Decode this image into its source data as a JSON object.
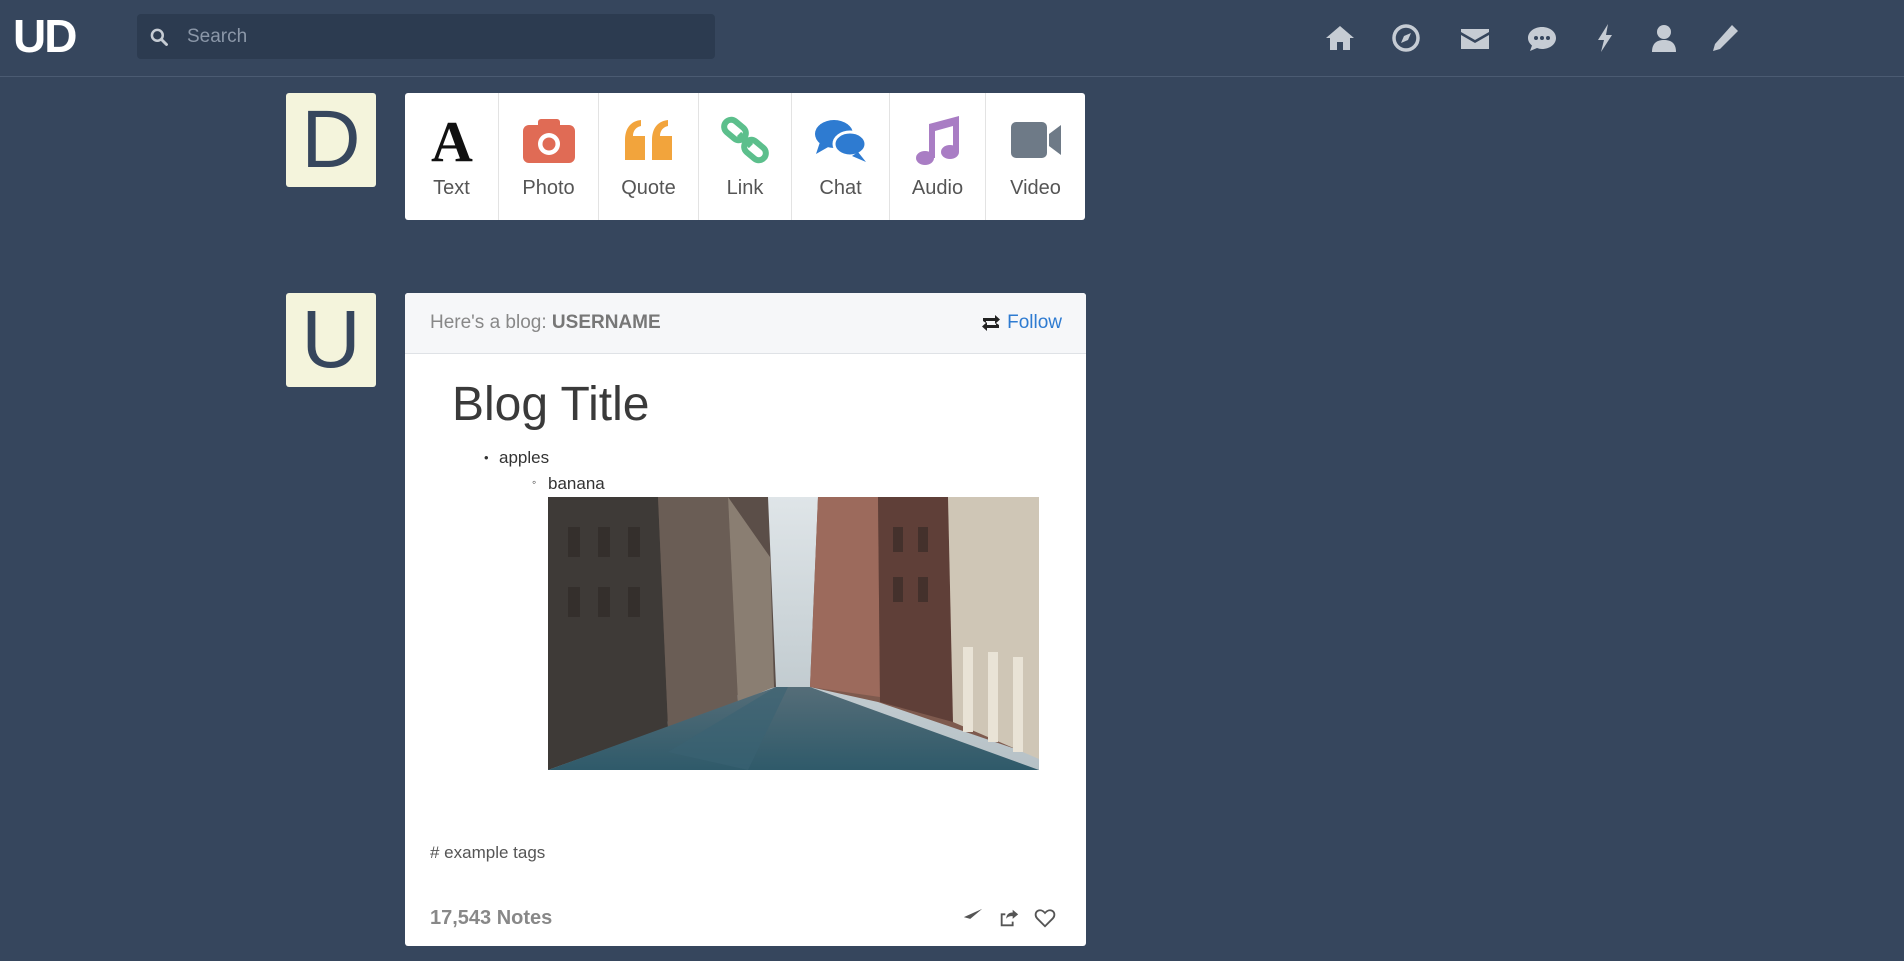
{
  "app": {
    "logo": "UD"
  },
  "search": {
    "placeholder": "Search",
    "value": ""
  },
  "nav": {
    "icons": [
      "home-icon",
      "explore-icon",
      "inbox-icon",
      "messages-icon",
      "activity-icon",
      "account-icon",
      "new-post-icon"
    ]
  },
  "avatars": {
    "dashboard_letter": "D",
    "blog_letter": "U"
  },
  "post_types": [
    {
      "label": "Text",
      "icon": "text-icon",
      "color": "#111111"
    },
    {
      "label": "Photo",
      "icon": "camera-icon",
      "color": "#e06b55"
    },
    {
      "label": "Quote",
      "icon": "quote-icon",
      "color": "#f2a43c"
    },
    {
      "label": "Link",
      "icon": "link-icon",
      "color": "#5cbf8c"
    },
    {
      "label": "Chat",
      "icon": "chat-icon",
      "color": "#2e7bd1"
    },
    {
      "label": "Audio",
      "icon": "music-icon",
      "color": "#a97dc4"
    },
    {
      "label": "Video",
      "icon": "video-icon",
      "color": "#6e7a87"
    }
  ],
  "post": {
    "prefix": "Here's a blog:",
    "username": "USERNAME",
    "follow": "Follow",
    "title": "Blog Title",
    "list": {
      "item1": "apples",
      "item2": "banana"
    },
    "tags": "# example tags",
    "notes": "17,543 Notes",
    "actions": [
      "send-icon",
      "reblog-icon",
      "heart-icon"
    ]
  },
  "colors": {
    "background": "#36465d",
    "accent": "#2e7bd1",
    "avatar_bg": "#f4f4dc"
  }
}
